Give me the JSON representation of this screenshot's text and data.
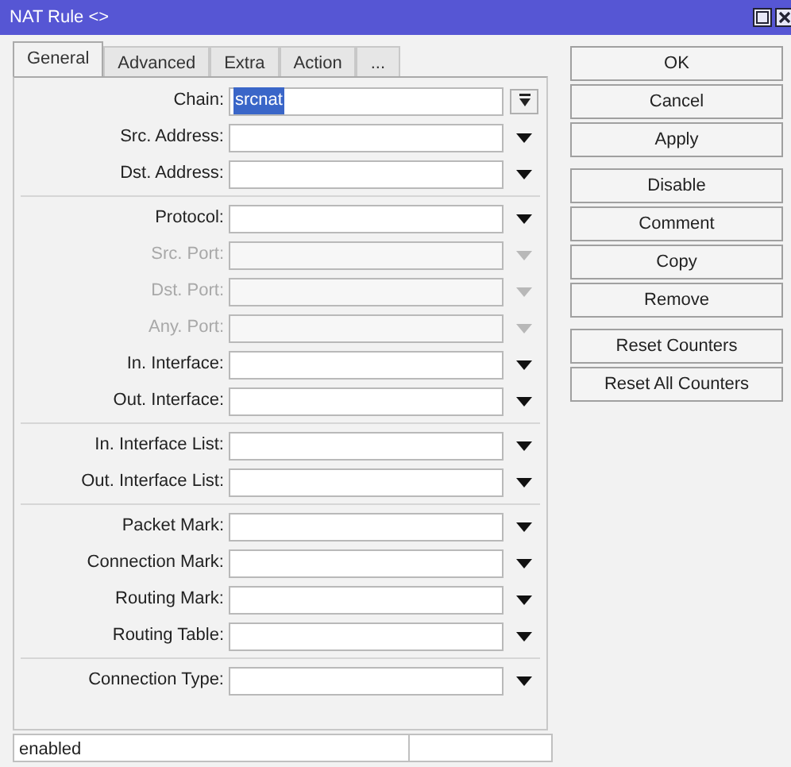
{
  "window": {
    "title": "NAT Rule <>"
  },
  "tabs": [
    {
      "label": "General",
      "selected": true
    },
    {
      "label": "Advanced",
      "selected": false
    },
    {
      "label": "Extra",
      "selected": false
    },
    {
      "label": "Action",
      "selected": false
    },
    {
      "label": "...",
      "selected": false
    }
  ],
  "groups": [
    [
      {
        "label": "Chain:",
        "kind": "combo",
        "value": "srcnat",
        "highlighted": true,
        "disabled": false
      },
      {
        "label": "Src. Address:",
        "kind": "dropdown",
        "disabled": false
      },
      {
        "label": "Dst. Address:",
        "kind": "dropdown",
        "disabled": false
      }
    ],
    [
      {
        "label": "Protocol:",
        "kind": "dropdown",
        "disabled": false
      },
      {
        "label": "Src. Port:",
        "kind": "dropdown",
        "disabled": true
      },
      {
        "label": "Dst. Port:",
        "kind": "dropdown",
        "disabled": true
      },
      {
        "label": "Any. Port:",
        "kind": "dropdown",
        "disabled": true
      },
      {
        "label": "In. Interface:",
        "kind": "dropdown",
        "disabled": false
      },
      {
        "label": "Out. Interface:",
        "kind": "dropdown",
        "disabled": false
      }
    ],
    [
      {
        "label": "In. Interface List:",
        "kind": "dropdown",
        "disabled": false
      },
      {
        "label": "Out. Interface List:",
        "kind": "dropdown",
        "disabled": false
      }
    ],
    [
      {
        "label": "Packet Mark:",
        "kind": "dropdown",
        "disabled": false
      },
      {
        "label": "Connection Mark:",
        "kind": "dropdown",
        "disabled": false
      },
      {
        "label": "Routing Mark:",
        "kind": "dropdown",
        "disabled": false
      },
      {
        "label": "Routing Table:",
        "kind": "dropdown",
        "disabled": false
      }
    ],
    [
      {
        "label": "Connection Type:",
        "kind": "dropdown",
        "disabled": false
      }
    ]
  ],
  "buttons": [
    [
      {
        "label": "OK"
      },
      {
        "label": "Cancel"
      },
      {
        "label": "Apply"
      }
    ],
    [
      {
        "label": "Disable"
      },
      {
        "label": "Comment"
      },
      {
        "label": "Copy"
      },
      {
        "label": "Remove"
      }
    ],
    [
      {
        "label": "Reset Counters"
      },
      {
        "label": "Reset All Counters"
      }
    ]
  ],
  "status_bar": {
    "text": "enabled"
  }
}
